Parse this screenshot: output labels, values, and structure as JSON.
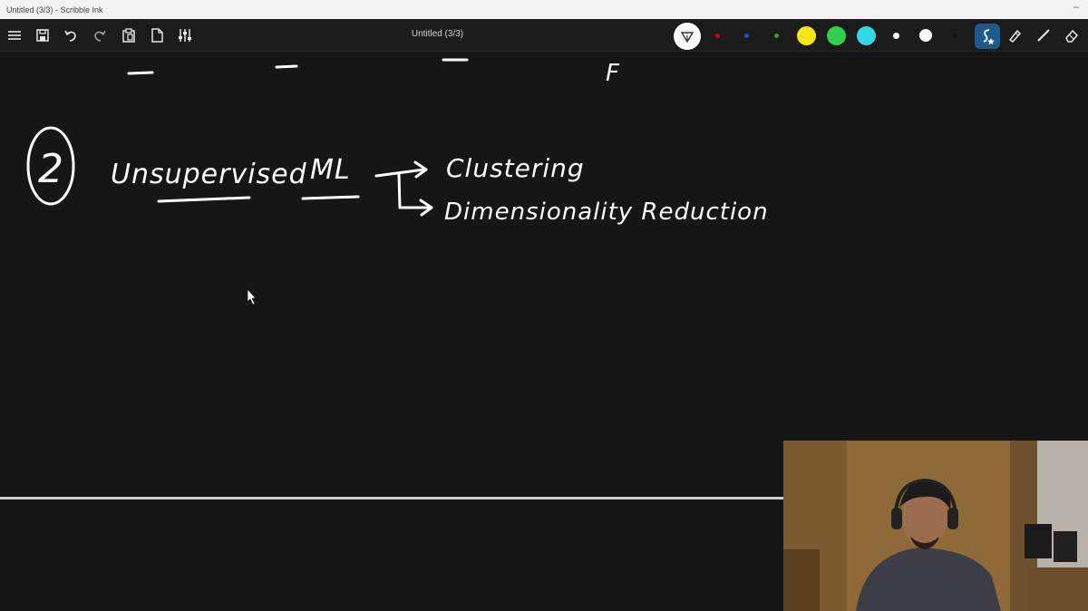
{
  "window": {
    "title": "Untitled (3/3) - Scribble Ink",
    "minimize_glyph": "–"
  },
  "toolbar": {
    "document_title": "Untitled (3/3)",
    "buttons": [
      {
        "name": "menu-icon"
      },
      {
        "name": "save-icon"
      },
      {
        "name": "undo-icon"
      },
      {
        "name": "redo-icon"
      },
      {
        "name": "paste-icon"
      },
      {
        "name": "new-page-icon"
      },
      {
        "name": "settings-sliders-icon"
      }
    ],
    "active_tool": "pen-nib-icon",
    "colors": [
      "#d0021b",
      "#1f4fd1",
      "#2aa52a",
      "#f5e616",
      "#2fd14a",
      "#2fd9e6",
      "#ffffff",
      "#ffffff",
      "#1b1b1b"
    ],
    "right_tools": [
      "stroke-style-icon",
      "highlighter-icon",
      "line-icon",
      "eraser-icon"
    ]
  },
  "canvas": {
    "number_label": "2",
    "heading_word1": "Unsupervised",
    "heading_word2": "ML",
    "branch_1": "Clustering",
    "branch_2": "Dimensionality Reduction",
    "top_letter": "F"
  },
  "webcam": {
    "description_name": "presenter-webcam"
  }
}
